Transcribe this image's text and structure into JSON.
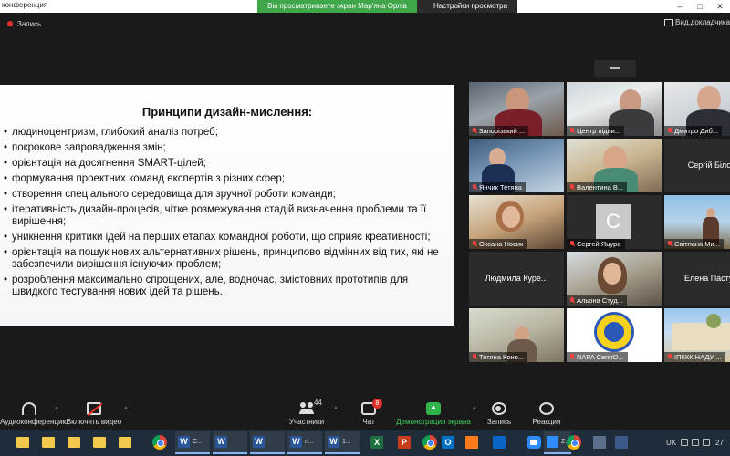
{
  "window": {
    "title": "конференция",
    "share_banner": "Вы просматриваете экран Мар'яна Орлів",
    "view_settings": "Настройки просмотра",
    "controls": [
      "–",
      "□",
      "✕"
    ]
  },
  "topbar": {
    "recording_label": "Запись",
    "gallery_label": "Вид.докладчика"
  },
  "slide": {
    "title": "Принципи дизайн-мислення:",
    "bullets": [
      "людиноцентризм, глибокий аналіз потреб;",
      "покрокове запровадження змін;",
      "орієнтація на досягнення SMART-цілей;",
      "формування проектних  команд експертів з різних сфер;",
      "створення спеціального середовища для зручної роботи команди;",
      "ітеративність дизайн-процесів, чітке розмежування стадій визначення проблеми та її вирішення;",
      "уникнення критики ідей на перших етапах командної роботи, що сприяє креативності;",
      " орієнтація на пошук нових альтернативних рішень, принципово відмінних від тих, які не забезпечили вирішення існуючих проблем;",
      "розроблення максимально спрощених, але, водночас, змістовних прототипів для швидкого тестування нових ідей та рішень."
    ]
  },
  "participants": [
    {
      "name": "Запорізький ...",
      "video": "v1"
    },
    {
      "name": "Центр підви...",
      "video": "v2"
    },
    {
      "name": "Дмитро Диб...",
      "video": "v3"
    },
    {
      "name": "Янчик Тетяна",
      "video": "v4"
    },
    {
      "name": "Валентина В...",
      "video": "v5"
    },
    {
      "name": "Сергій Білор",
      "video": "none"
    },
    {
      "name": "Оксана Носик",
      "video": "v6"
    },
    {
      "name": "Сергей Яцура",
      "video": "avatar",
      "initial": "C"
    },
    {
      "name": "Світлана Ми...",
      "video": "v7"
    },
    {
      "name": "Людмила  Куре...",
      "video": "none"
    },
    {
      "name": "Альона Студ...",
      "video": "v8"
    },
    {
      "name": "Елена Пасту...",
      "video": "none"
    },
    {
      "name": "Тетяна Коно...",
      "video": "v9"
    },
    {
      "name": "NAPA CentrD...",
      "video": "v10"
    },
    {
      "name": "ІПККК НАДУ ...",
      "video": "v11"
    }
  ],
  "toolbar": {
    "audio_label": "Аудиоконференцию",
    "video_label": "Включить видео",
    "participants_label": "Участники",
    "participants_count": "44",
    "chat_label": "Чат",
    "chat_badge": "8",
    "share_label": "Демонстрация экрана",
    "record_label": "Запись",
    "reactions_label": "Реакции",
    "caret": "^"
  },
  "taskbar": {
    "word_items": [
      "C...",
      "",
      "",
      "n...",
      "n...",
      "1..."
    ],
    "excel": "X",
    "powerpoint": "P",
    "outlook": "O",
    "zoom_label": "Z...",
    "language": "UK",
    "time": "27"
  },
  "colors": {
    "share_green": "#3fa64a",
    "record_red": "#e0312b",
    "zoom_blue": "#2d8cff",
    "word_blue": "#2b579a"
  }
}
